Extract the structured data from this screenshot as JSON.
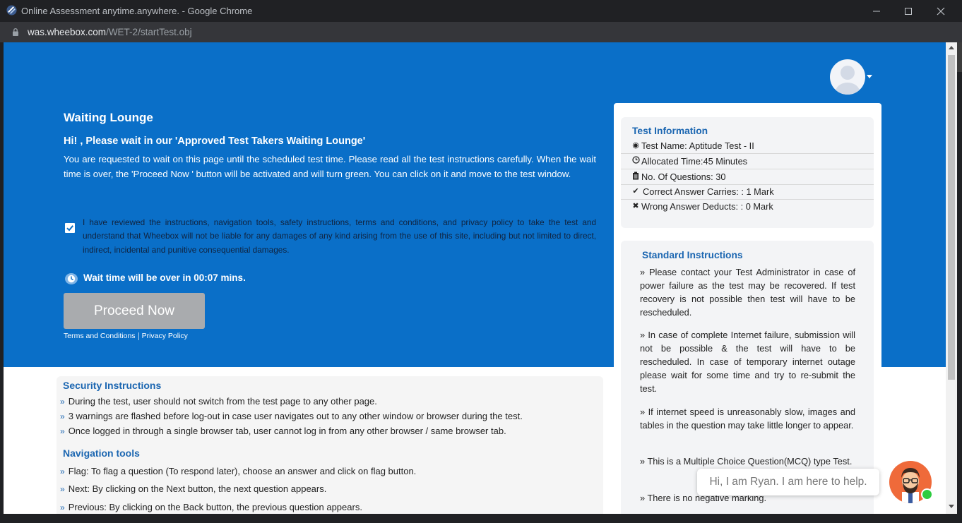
{
  "window": {
    "title": "Online Assessment anytime.anywhere. - Google Chrome",
    "url_host": "was.wheebox.com",
    "url_path": "/WET-2/startTest.obj"
  },
  "lounge": {
    "title": "Waiting Lounge",
    "subtitle": "Hi! , Please wait in our 'Approved Test Takers Waiting Lounge'",
    "description": "You are requested to wait on this page until the scheduled test time. Please read all the test instructions carefully. When the wait time is over, the 'Proceed Now ' button will be activated and will turn green. You can click on it and move to the test window.",
    "agreement": "I have reviewed the instructions, navigation tools, safety instructions, terms and conditions, and privacy policy to take the test and understand that Wheebox will not be liable for any damages of any kind arising from the use of this site, including but not limited to direct, indirect, incidental and punitive consequential damages.",
    "agreement_checked": true,
    "wait_text": "Wait time will be over in 00:07 mins.",
    "proceed_label": "Proceed Now",
    "terms_label": "Terms and Conditions",
    "privacy_label": "Privacy Policy"
  },
  "security": {
    "title": "Security Instructions",
    "items": [
      "During the test, user should not switch from the test page to any other page.",
      "3 warnings are flashed before log-out in case user navigates out to any other window or browser during the test.",
      "Once logged in through a single browser tab, user cannot log in from any other browser / same browser tab."
    ]
  },
  "navigation": {
    "title": "Navigation tools",
    "items": [
      "Flag: To flag a question (To respond later), choose an answer and click on flag button.",
      "Next: By clicking on the Next button, the next question appears.",
      "Previous: By clicking on the Back button, the previous question appears."
    ]
  },
  "test_info": {
    "title": "Test Information",
    "rows": [
      {
        "icon": "target-icon",
        "text": "Test Name: Aptitude Test - II"
      },
      {
        "icon": "clock-icon",
        "text": "Allocated Time:45 Minutes"
      },
      {
        "icon": "clipboard-icon",
        "text": "No. Of Questions: 30"
      },
      {
        "icon": "check-icon",
        "text": "Correct Answer Carries: : 1 Mark"
      },
      {
        "icon": "cross-icon",
        "text": "Wrong Answer Deducts: : 0 Mark"
      }
    ]
  },
  "standard": {
    "title": "Standard Instructions",
    "items": [
      "» Please contact your Test Administrator in case of power failure as the test may be recovered. If test recovery is not possible then test will have to be rescheduled.",
      "» In case of complete Internet failure, submission will not be possible & the test will have to be rescheduled. In case of temporary internet outage please wait for some time and try to re-submit the test.",
      "» If internet speed is unreasonably slow, images and tables in the question may take little longer to appear.",
      "» This is a Multiple Choice Question(MCQ) type Test.",
      "» There is no negative marking."
    ]
  },
  "chat": {
    "message": "Hi, I am Ryan. I am here to help."
  },
  "colors": {
    "hero_blue": "#0a6fc8",
    "heading_blue": "#1b66b1",
    "button_gray": "#a9abae",
    "chat_orange": "#ef6a3a"
  }
}
